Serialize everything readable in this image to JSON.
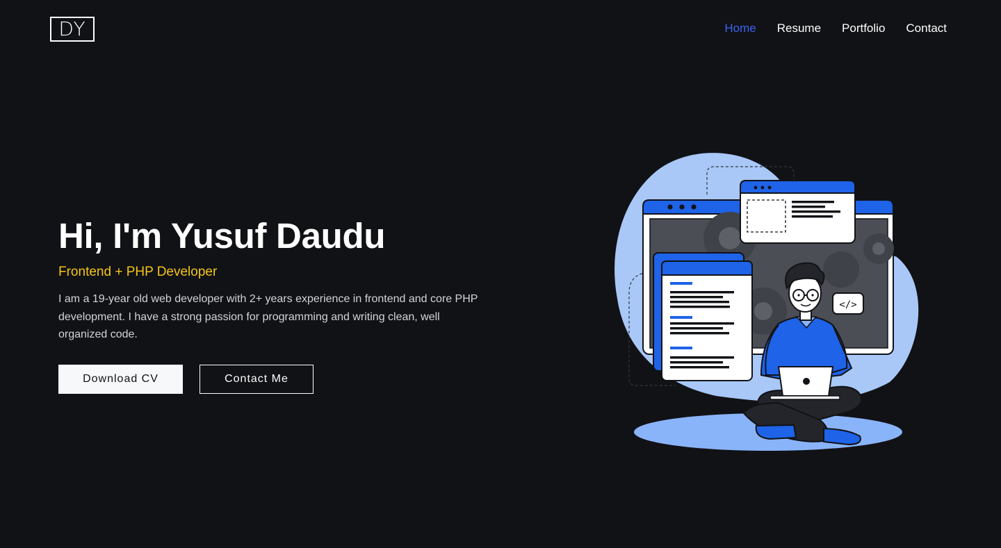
{
  "logo": {
    "text": "DY"
  },
  "nav": {
    "items": [
      {
        "label": "Home",
        "active": true
      },
      {
        "label": "Resume",
        "active": false
      },
      {
        "label": "Portfolio",
        "active": false
      },
      {
        "label": "Contact",
        "active": false
      }
    ]
  },
  "hero": {
    "title": "Hi, I'm Yusuf Daudu",
    "subtitle": "Frontend + PHP Developer",
    "description": "I am a 19-year old web developer with 2+ years experience in frontend and core PHP development. I have a strong passion for programming and writing clean, well organized code.",
    "download_label": "Download CV",
    "contact_label": "Contact Me"
  },
  "illustration": {
    "code_tag": "</>"
  },
  "colors": {
    "background": "#111216",
    "accent": "#3b63f0",
    "subtitle": "#f5c518",
    "illustration_blue": "#1e63e8",
    "illustration_light": "#a9c8f8"
  }
}
